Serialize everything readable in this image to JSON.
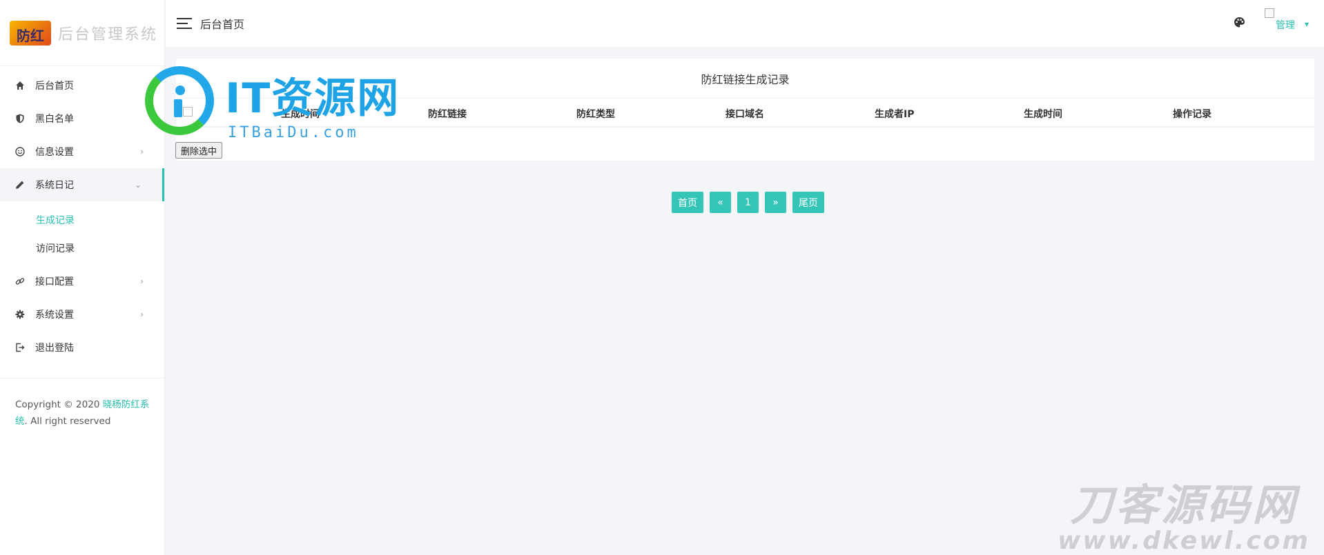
{
  "brand": {
    "logo_text": "防红",
    "title": "后台管理系统"
  },
  "sidebar": {
    "items": [
      {
        "label": "后台首页",
        "icon": "home-icon"
      },
      {
        "label": "黑白名单",
        "icon": "shield-icon"
      },
      {
        "label": "信息设置",
        "icon": "smile-icon",
        "arrow": "›"
      },
      {
        "label": "系统日记",
        "icon": "pencil-icon",
        "arrow": "⌄"
      },
      {
        "label": "接口配置",
        "icon": "link-icon",
        "arrow": "›"
      },
      {
        "label": "系统设置",
        "icon": "gear-icon",
        "arrow": "›"
      },
      {
        "label": "退出登陆",
        "icon": "logout-icon"
      }
    ],
    "submenu": [
      {
        "label": "生成记录",
        "active": true
      },
      {
        "label": "访问记录",
        "active": false
      }
    ],
    "footer": {
      "prefix": "Copyright © 2020 ",
      "link": "晓杨防红系统",
      "suffix": ". All right reserved"
    }
  },
  "header": {
    "title": "后台首页",
    "user": "管理"
  },
  "card": {
    "title": "防红链接生成记录",
    "columns": [
      "生成时间",
      "防红链接",
      "防红类型",
      "接口域名",
      "生成者IP",
      "生成时间",
      "操作记录"
    ],
    "delete_label": "删除选中"
  },
  "pagination": {
    "first": "首页",
    "prev": "«",
    "page": "1",
    "next": "»",
    "last": "尾页"
  },
  "watermarks": {
    "top": {
      "main": "IT资源网",
      "sub": "ITBaiDu.com"
    },
    "bottom": {
      "main": "刀客源码网",
      "sub": "www.dkewl.com"
    }
  },
  "colors": {
    "accent": "#28c0b1",
    "pager": "#35c5b7",
    "background": "#f4f5f9"
  }
}
